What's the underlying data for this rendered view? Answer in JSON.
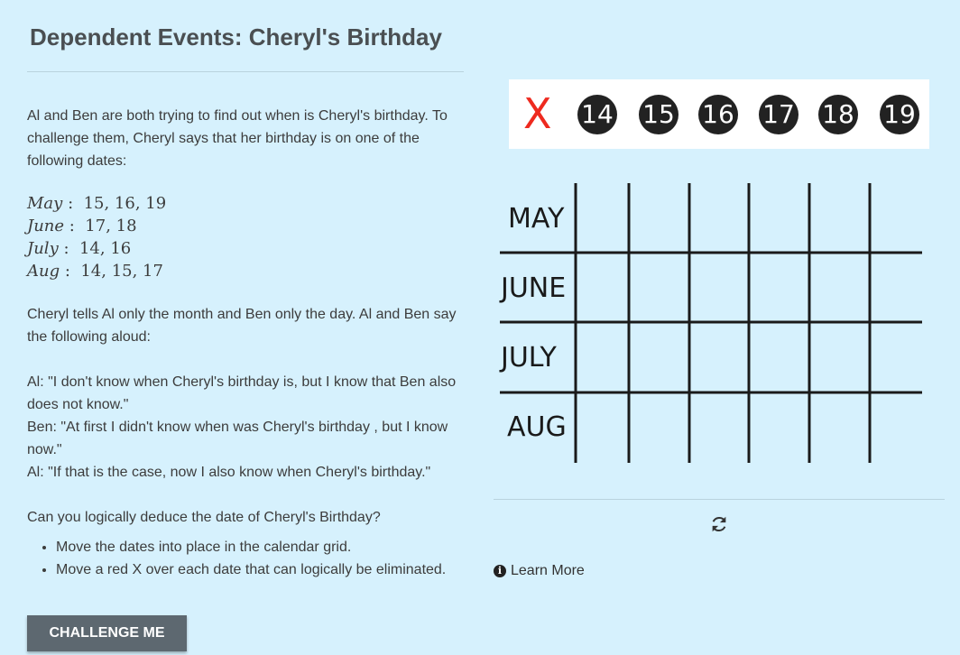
{
  "title": "Dependent Events: Cheryl's Birthday",
  "intro": "Al and Ben are both trying to find out when is Cheryl's birthday. To challenge them, Cheryl says that her birthday is on one of the following dates:",
  "date_options": [
    {
      "month": "May",
      "days": "15,  16,  19"
    },
    {
      "month": "June",
      "days": "17,  18"
    },
    {
      "month": "July",
      "days": "14,  16"
    },
    {
      "month": "Aug",
      "days": "14,  15,  17"
    }
  ],
  "setup": "Cheryl tells Al only the month and Ben only the day. Al and Ben say the following aloud:",
  "dialogue": [
    "Al: \"I don't know when Cheryl's birthday is, but I know that Ben also does not know.\"",
    "Ben: \"At first I didn't know when was Cheryl's birthday , but I know now.\"",
    "Al: \"If that is the case, now I also know when Cheryl's birthday.\""
  ],
  "question": "Can you logically deduce the date of Cheryl's Birthday?",
  "instructions": [
    "Move the dates into place in the calendar grid.",
    "Move a red X over each date that can logically be eliminated."
  ],
  "challenge_button": "CHALLENGE ME",
  "tray": {
    "x_mark": "X",
    "x_color": "#ee2a1f",
    "chips": [
      "14",
      "15",
      "16",
      "17",
      "18",
      "19"
    ]
  },
  "grid": {
    "rows": [
      "MAY",
      "JUNE",
      "JULY",
      "AUG"
    ],
    "columns": 6
  },
  "reset_icon": "refresh-icon",
  "learn_more": "Learn More"
}
